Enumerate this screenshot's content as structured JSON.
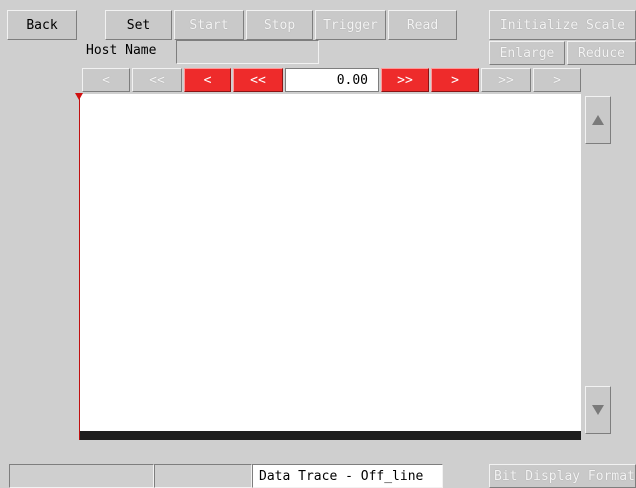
{
  "toolbar": {
    "back": "Back",
    "set": "Set",
    "start": "Start",
    "stop": "Stop",
    "trigger": "Trigger",
    "read": "Read",
    "initialize_scale": "Initialize Scale",
    "enlarge": "Enlarge",
    "reduce": "Reduce"
  },
  "host": {
    "label": "Host Name",
    "value": ""
  },
  "nav": {
    "scroll_left": "<",
    "scroll_left_fast": "<<",
    "red_left": "<",
    "red_left_fast": "<<",
    "position_value": "0.00",
    "red_right_fast": ">>",
    "red_right": ">",
    "scroll_right_fast": ">>",
    "scroll_right": ">"
  },
  "scrollbar": {
    "up_icon": "triangle-up-icon",
    "down_icon": "triangle-down-icon"
  },
  "statusbar": {
    "cell1": "",
    "cell2": "",
    "mode": "Data Trace - Off_line",
    "bit_display_format": "Bit Display Format"
  },
  "colors": {
    "accent_red": "#ee2b2b",
    "background": "#cfcfcf",
    "plot": "#ffffff"
  }
}
